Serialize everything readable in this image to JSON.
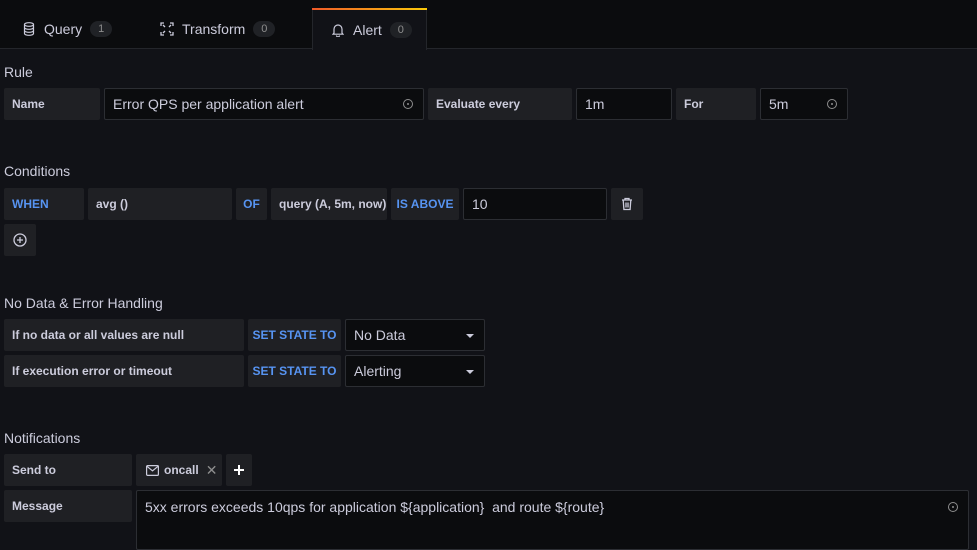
{
  "tabs": [
    {
      "label": "Query",
      "count": "1",
      "icon": "database-icon",
      "active": false
    },
    {
      "label": "Transform",
      "count": "0",
      "icon": "transform-icon",
      "active": false
    },
    {
      "label": "Alert",
      "count": "0",
      "icon": "bell-icon",
      "active": true
    }
  ],
  "rule": {
    "title": "Rule",
    "name_label": "Name",
    "name_value": "Error QPS per application alert",
    "evaluate_label": "Evaluate every",
    "evaluate_value": "1m",
    "for_label": "For",
    "for_value": "5m"
  },
  "conditions": {
    "title": "Conditions",
    "when_label": "WHEN",
    "reducer": "avg ()",
    "of_label": "OF",
    "query": "query (A, 5m, now)",
    "evaluator": "IS ABOVE",
    "threshold": "10"
  },
  "nodata": {
    "title": "No Data & Error Handling",
    "rows": [
      {
        "label": "If no data or all values are null",
        "action": "SET STATE TO",
        "value": "No Data"
      },
      {
        "label": "If execution error or timeout",
        "action": "SET STATE TO",
        "value": "Alerting"
      }
    ]
  },
  "notifications": {
    "title": "Notifications",
    "send_to_label": "Send to",
    "recipients": [
      {
        "name": "oncall",
        "icon": "envelope-icon"
      }
    ],
    "message_label": "Message",
    "message_value": "5xx errors exceeds 10qps for application ${application}  and route ${route}"
  },
  "colors": {
    "accent_blue": "#5794f2",
    "active_tab_gradient": [
      "#f05a28",
      "#fbca0a"
    ],
    "background": "#111217"
  }
}
